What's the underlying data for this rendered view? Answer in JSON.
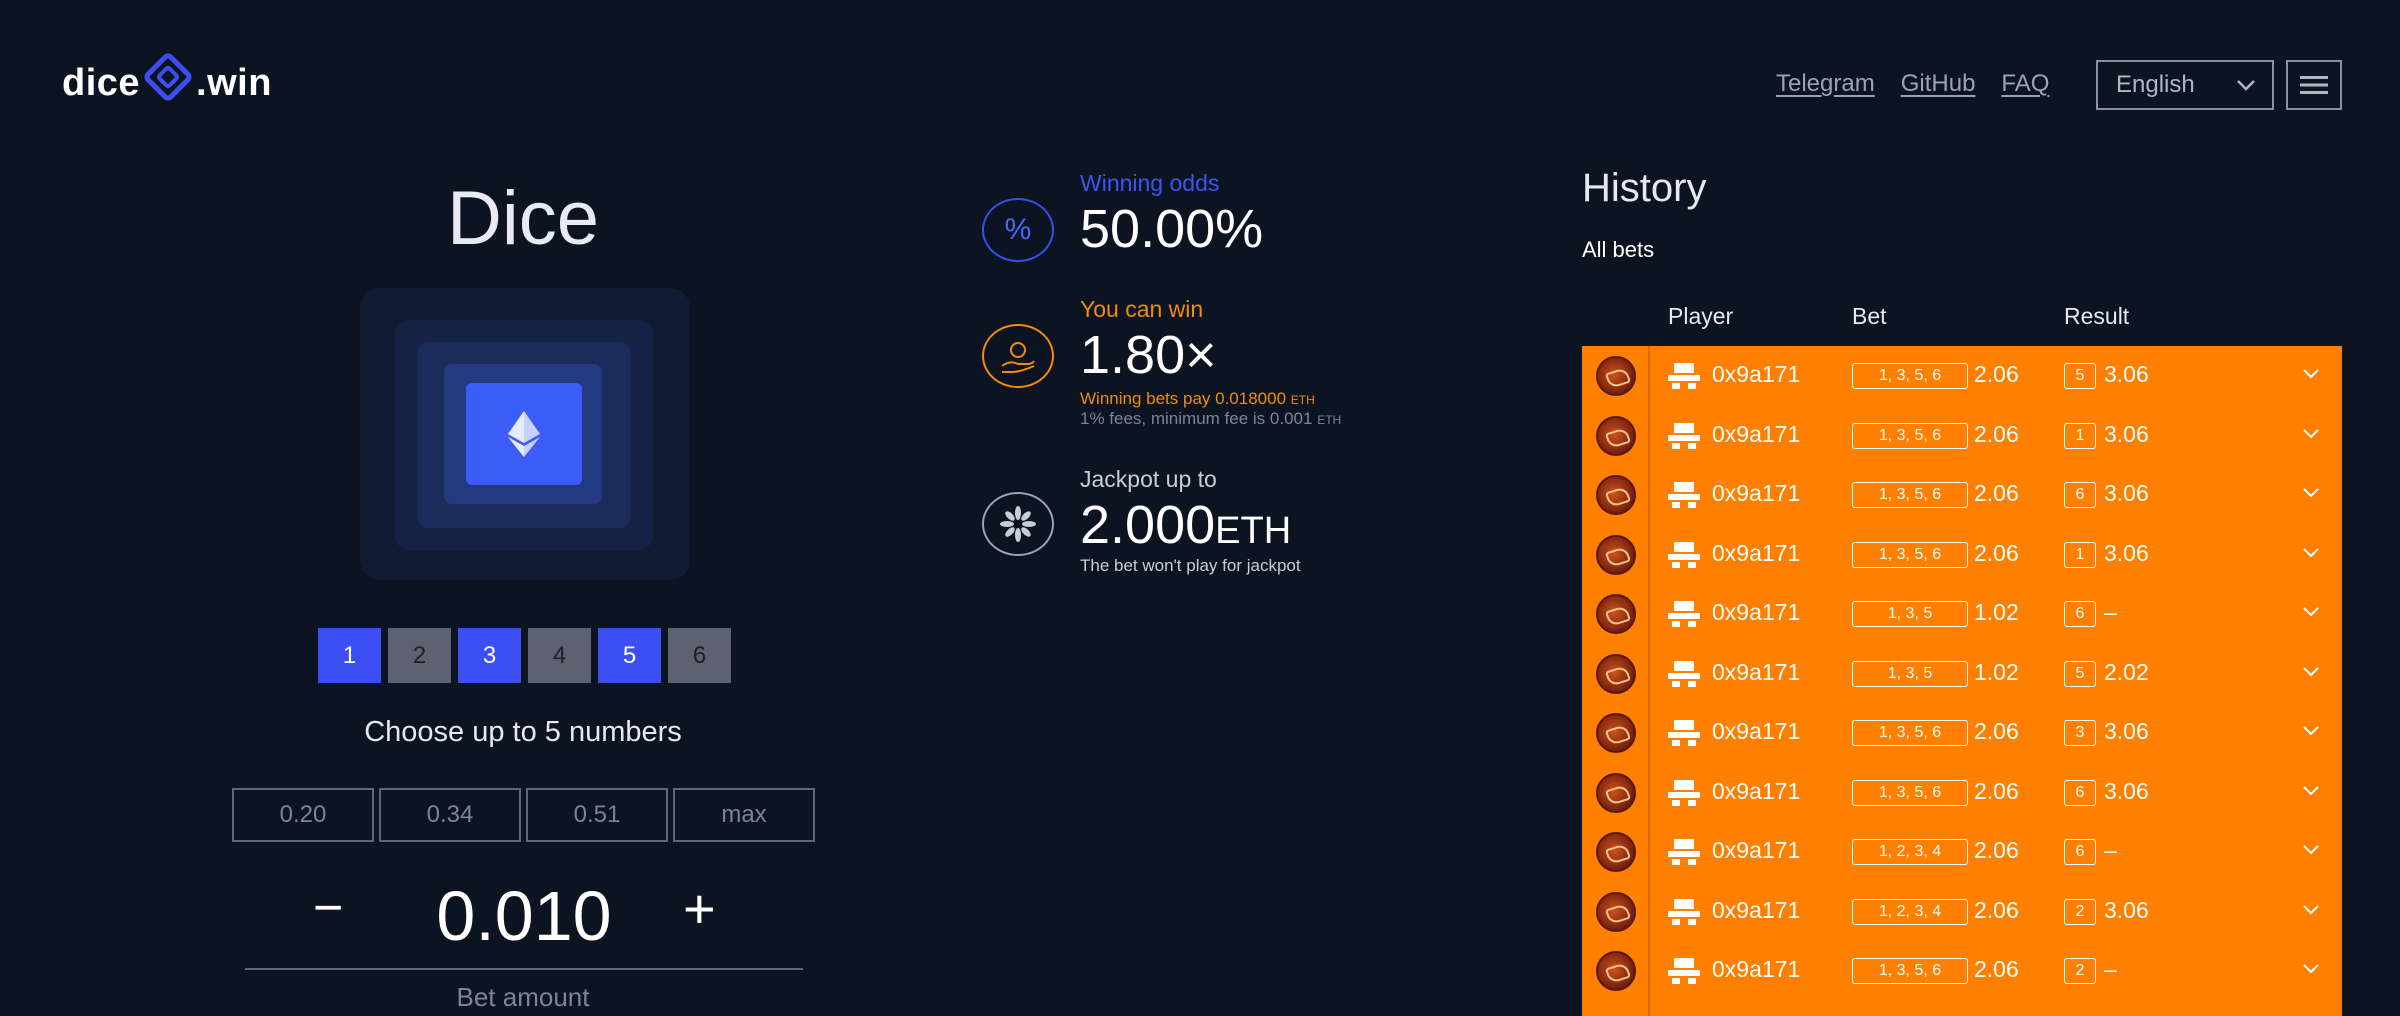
{
  "header": {
    "logo_left": "dice",
    "logo_right": ".win",
    "nav": [
      "Telegram",
      "GitHub",
      "FAQ"
    ],
    "language": "English"
  },
  "game": {
    "title": "Dice",
    "numbers": [
      {
        "label": "1",
        "selected": true
      },
      {
        "label": "2",
        "selected": false
      },
      {
        "label": "3",
        "selected": true
      },
      {
        "label": "4",
        "selected": false
      },
      {
        "label": "5",
        "selected": true
      },
      {
        "label": "6",
        "selected": false
      }
    ],
    "choose_text": "Choose up to 5 numbers",
    "presets": [
      "0.20",
      "0.34",
      "0.51",
      "max"
    ],
    "minus": "−",
    "plus": "+",
    "amount": "0.010",
    "amount_label": "Bet amount"
  },
  "stats": {
    "odds_label": "Winning odds",
    "odds_value": "50.00%",
    "win_label": "You can win",
    "win_value": "1.80×",
    "pay_text": "Winning bets pay 0.018000",
    "pay_unit": "ETH",
    "fee_text": "1% fees, minimum fee is 0.001",
    "fee_unit": "ETH",
    "jackpot_label": "Jackpot up to",
    "jackpot_value": "2.000",
    "jackpot_unit": "ETH",
    "jackpot_note": "The bet won't play for jackpot"
  },
  "history": {
    "title": "History",
    "filter": "All bets",
    "columns": {
      "player": "Player",
      "bet": "Bet",
      "result": "Result"
    },
    "rows": [
      {
        "player": "0x9a171",
        "bet": "1, 3, 5, 6",
        "bet_value": "2.06",
        "result_num": "5",
        "result_value": "3.06"
      },
      {
        "player": "0x9a171",
        "bet": "1, 3, 5, 6",
        "bet_value": "2.06",
        "result_num": "1",
        "result_value": "3.06"
      },
      {
        "player": "0x9a171",
        "bet": "1, 3, 5, 6",
        "bet_value": "2.06",
        "result_num": "6",
        "result_value": "3.06"
      },
      {
        "player": "0x9a171",
        "bet": "1, 3, 5, 6",
        "bet_value": "2.06",
        "result_num": "1",
        "result_value": "3.06"
      },
      {
        "player": "0x9a171",
        "bet": "1, 3, 5",
        "bet_value": "1.02",
        "result_num": "6",
        "result_value": "–"
      },
      {
        "player": "0x9a171",
        "bet": "1, 3, 5",
        "bet_value": "1.02",
        "result_num": "5",
        "result_value": "2.02"
      },
      {
        "player": "0x9a171",
        "bet": "1, 3, 5, 6",
        "bet_value": "2.06",
        "result_num": "3",
        "result_value": "3.06"
      },
      {
        "player": "0x9a171",
        "bet": "1, 3, 5, 6",
        "bet_value": "2.06",
        "result_num": "6",
        "result_value": "3.06"
      },
      {
        "player": "0x9a171",
        "bet": "1, 2, 3, 4",
        "bet_value": "2.06",
        "result_num": "6",
        "result_value": "–"
      },
      {
        "player": "0x9a171",
        "bet": "1, 2, 3, 4",
        "bet_value": "2.06",
        "result_num": "2",
        "result_value": "3.06"
      },
      {
        "player": "0x9a171",
        "bet": "1, 3, 5, 6",
        "bet_value": "2.06",
        "result_num": "2",
        "result_value": "–"
      }
    ]
  },
  "colors": {
    "background": "#0d1421",
    "accent_blue": "#3d4ff2",
    "accent_orange": "#ff7f00"
  }
}
